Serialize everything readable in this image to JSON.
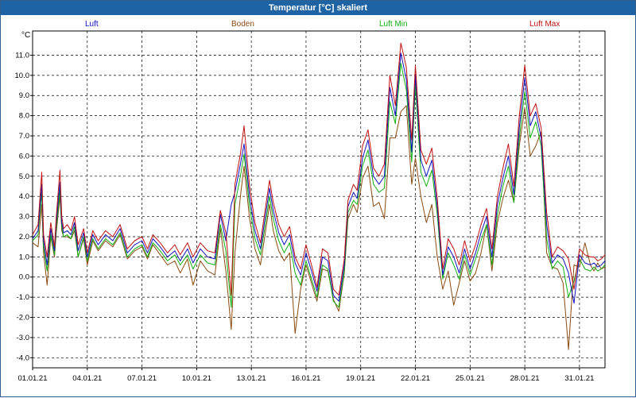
{
  "window": {
    "title": "Temperatur [°C] skaliert"
  },
  "legend": [
    {
      "label": "Luft",
      "color": "#1010c0"
    },
    {
      "label": "Boden",
      "color": "#8b4a10"
    },
    {
      "label": "Luft Min",
      "color": "#10b010"
    },
    {
      "label": "Luft Max",
      "color": "#c01010"
    }
  ],
  "chart_data": {
    "type": "line",
    "title": "Temperatur [°C] skaliert",
    "ylabel": "°C",
    "xlabel": "",
    "ylim": [
      -4.5,
      12.2
    ],
    "xlim": [
      0,
      31.4
    ],
    "grid": true,
    "x_ticks": [
      "01.01.21",
      "04.01.21",
      "07.01.21",
      "10.01.21",
      "13.01.21",
      "16.01.21",
      "19.01.21",
      "22.01.21",
      "25.01.21",
      "28.01.21",
      "31.01.21"
    ],
    "y_ticks": [
      -4.0,
      -3.0,
      -2.0,
      -1.0,
      0.0,
      1.0,
      2.0,
      3.0,
      4.0,
      5.0,
      6.0,
      7.0,
      8.0,
      9.0,
      10.0,
      11.0
    ],
    "x_unit": "days since 01.01.21",
    "series": [
      {
        "name": "Luft",
        "color": "#1010c0",
        "x": [
          0,
          0.3,
          0.5,
          0.6,
          0.8,
          1.0,
          1.2,
          1.3,
          1.5,
          1.6,
          1.7,
          1.9,
          2.1,
          2.3,
          2.5,
          2.8,
          3.0,
          3.3,
          3.6,
          4.0,
          4.4,
          4.8,
          5.2,
          5.6,
          6.0,
          6.3,
          6.6,
          7.0,
          7.4,
          7.8,
          8.1,
          8.5,
          8.8,
          9.2,
          9.6,
          10.0,
          10.3,
          10.6,
          10.9,
          11.1,
          11.4,
          11.6,
          11.9,
          12.2,
          12.5,
          12.8,
          13.0,
          13.2,
          13.5,
          13.8,
          14.1,
          14.4,
          14.7,
          15.0,
          15.3,
          15.6,
          15.9,
          16.2,
          16.5,
          16.8,
          17.1,
          17.3,
          17.6,
          17.8,
          18.1,
          18.4,
          18.7,
          19.0,
          19.3,
          19.6,
          19.9,
          20.2,
          20.5,
          20.8,
          21.0,
          21.3,
          21.6,
          21.9,
          22.2,
          22.5,
          22.8,
          23.1,
          23.4,
          23.7,
          24.0,
          24.3,
          24.6,
          24.9,
          25.2,
          25.5,
          25.8,
          26.1,
          26.4,
          26.7,
          27.0,
          27.3,
          27.6,
          27.9,
          28.2,
          28.5,
          28.8,
          29.1,
          29.4,
          29.7,
          30.0,
          30.3,
          30.6,
          30.8,
          31.0,
          31.2,
          31.4
        ],
        "y": [
          1.9,
          2.3,
          4.6,
          1.8,
          0.6,
          2.4,
          1.3,
          2.7,
          4.7,
          2.7,
          2.2,
          2.3,
          2.1,
          2.7,
          1.3,
          2.2,
          1.0,
          2.1,
          1.6,
          2.1,
          1.8,
          2.4,
          1.2,
          1.6,
          1.8,
          1.2,
          1.9,
          1.5,
          1.0,
          1.3,
          0.8,
          1.4,
          0.7,
          1.4,
          1.0,
          0.9,
          3.1,
          1.8,
          3.6,
          4.2,
          5.6,
          6.6,
          4.0,
          2.3,
          1.4,
          3.2,
          4.4,
          3.3,
          2.2,
          1.6,
          2.1,
          0.7,
          0.1,
          1.2,
          0.3,
          -0.7,
          1.0,
          0.8,
          -0.9,
          -1.2,
          0.6,
          3.5,
          4.2,
          3.9,
          5.9,
          6.8,
          5.0,
          4.6,
          5.0,
          9.4,
          8.0,
          11.1,
          9.8,
          6.2,
          10.0,
          5.8,
          5.0,
          5.8,
          3.5,
          0.1,
          1.5,
          1.0,
          0.2,
          1.4,
          0.4,
          1.2,
          2.2,
          3.0,
          1.0,
          3.6,
          4.9,
          6.0,
          4.1,
          7.4,
          9.9,
          7.5,
          8.2,
          6.9,
          2.6,
          0.7,
          1.1,
          0.9,
          0.2,
          -1.3,
          1.1,
          0.7,
          0.6,
          0.7,
          0.5,
          0.6,
          0.8
        ]
      },
      {
        "name": "Boden",
        "color": "#8b4a10",
        "x": [
          0,
          0.3,
          0.5,
          0.6,
          0.8,
          1.0,
          1.2,
          1.3,
          1.5,
          1.6,
          1.7,
          1.9,
          2.1,
          2.3,
          2.5,
          2.8,
          3.0,
          3.3,
          3.6,
          4.0,
          4.4,
          4.8,
          5.2,
          5.6,
          6.0,
          6.3,
          6.6,
          7.0,
          7.4,
          7.8,
          8.1,
          8.5,
          8.8,
          9.2,
          9.6,
          10.0,
          10.3,
          10.6,
          10.9,
          11.1,
          11.4,
          11.6,
          11.9,
          12.2,
          12.5,
          12.8,
          13.0,
          13.2,
          13.5,
          13.8,
          14.1,
          14.4,
          14.7,
          15.0,
          15.3,
          15.6,
          15.9,
          16.2,
          16.5,
          16.8,
          17.1,
          17.3,
          17.6,
          17.8,
          18.1,
          18.4,
          18.7,
          19.0,
          19.3,
          19.6,
          19.9,
          20.2,
          20.5,
          20.8,
          21.0,
          21.3,
          21.6,
          21.9,
          22.2,
          22.5,
          22.8,
          23.1,
          23.4,
          23.7,
          24.0,
          24.3,
          24.6,
          24.9,
          25.2,
          25.5,
          25.8,
          26.1,
          26.4,
          26.7,
          27.0,
          27.3,
          27.6,
          27.9,
          28.2,
          28.5,
          28.8,
          29.1,
          29.4,
          29.7,
          30.0,
          30.3,
          30.6,
          30.8,
          31.0,
          31.2,
          31.4
        ],
        "y": [
          1.7,
          1.5,
          3.6,
          1.2,
          -0.4,
          2.0,
          1.0,
          2.2,
          4.0,
          2.3,
          2.0,
          2.0,
          1.9,
          2.3,
          1.0,
          1.9,
          0.6,
          1.8,
          1.3,
          1.8,
          1.5,
          2.1,
          0.9,
          1.3,
          1.5,
          0.9,
          1.6,
          1.1,
          0.6,
          0.8,
          0.2,
          0.9,
          -0.4,
          0.8,
          0.3,
          0.1,
          2.4,
          0.3,
          -2.6,
          1.2,
          4.0,
          5.5,
          2.9,
          1.4,
          0.6,
          2.4,
          3.6,
          2.3,
          1.3,
          0.8,
          1.2,
          -2.8,
          -0.6,
          0.6,
          -0.3,
          -1.2,
          0.4,
          0.3,
          -1.1,
          -1.7,
          0.2,
          2.9,
          3.6,
          3.2,
          4.9,
          5.5,
          3.5,
          3.7,
          2.9,
          6.9,
          6.9,
          8.2,
          8.5,
          4.6,
          5.9,
          4.0,
          2.7,
          3.6,
          1.0,
          -0.6,
          0.3,
          -1.4,
          -0.3,
          0.8,
          -0.2,
          0.2,
          1.2,
          2.6,
          0.3,
          2.7,
          3.9,
          4.8,
          3.7,
          6.5,
          8.4,
          6.0,
          6.5,
          7.2,
          1.2,
          0.5,
          0.4,
          -0.3,
          -3.6,
          0.6,
          0.5,
          1.7,
          0.6,
          0.3,
          0.7,
          0.4,
          0.5
        ]
      },
      {
        "name": "Luft Min",
        "color": "#10b010",
        "x": [
          0,
          0.3,
          0.5,
          0.6,
          0.8,
          1.0,
          1.2,
          1.3,
          1.5,
          1.6,
          1.7,
          1.9,
          2.1,
          2.3,
          2.5,
          2.8,
          3.0,
          3.3,
          3.6,
          4.0,
          4.4,
          4.8,
          5.2,
          5.6,
          6.0,
          6.3,
          6.6,
          7.0,
          7.4,
          7.8,
          8.1,
          8.5,
          8.8,
          9.2,
          9.6,
          10.0,
          10.3,
          10.6,
          10.9,
          11.1,
          11.4,
          11.6,
          11.9,
          12.2,
          12.5,
          12.8,
          13.0,
          13.2,
          13.5,
          13.8,
          14.1,
          14.4,
          14.7,
          15.0,
          15.3,
          15.6,
          15.9,
          16.2,
          16.5,
          16.8,
          17.1,
          17.3,
          17.6,
          17.8,
          18.1,
          18.4,
          18.7,
          19.0,
          19.3,
          19.6,
          19.9,
          20.2,
          20.5,
          20.8,
          21.0,
          21.3,
          21.6,
          21.9,
          22.2,
          22.5,
          22.8,
          23.1,
          23.4,
          23.7,
          24.0,
          24.3,
          24.6,
          24.9,
          25.2,
          25.5,
          25.8,
          26.1,
          26.4,
          26.7,
          27.0,
          27.3,
          27.6,
          27.9,
          28.2,
          28.5,
          28.8,
          29.1,
          29.4,
          29.7,
          30.0,
          30.3,
          30.6,
          30.8,
          31.0,
          31.2,
          31.4
        ],
        "y": [
          1.8,
          2.1,
          4.2,
          1.5,
          0.3,
          2.1,
          1.1,
          2.4,
          4.3,
          2.5,
          2.0,
          2.1,
          1.9,
          2.5,
          1.0,
          2.0,
          0.8,
          1.9,
          1.4,
          1.9,
          1.6,
          2.2,
          1.0,
          1.4,
          1.6,
          1.0,
          1.7,
          1.3,
          0.8,
          1.1,
          0.6,
          1.1,
          0.4,
          1.1,
          0.7,
          0.6,
          2.6,
          1.3,
          -1.5,
          3.6,
          5.0,
          6.1,
          3.5,
          1.9,
          1.1,
          2.8,
          4.0,
          2.9,
          1.8,
          1.2,
          1.7,
          0.2,
          -0.4,
          0.8,
          -0.1,
          -1.0,
          0.6,
          0.4,
          -1.2,
          -1.5,
          0.3,
          3.2,
          3.8,
          3.6,
          5.5,
          6.3,
          4.6,
          4.2,
          4.4,
          8.7,
          7.6,
          10.6,
          9.3,
          5.7,
          9.5,
          5.2,
          4.5,
          5.3,
          3.1,
          -0.1,
          1.2,
          0.6,
          -0.1,
          1.1,
          0.1,
          0.9,
          1.8,
          2.6,
          0.6,
          3.1,
          4.5,
          5.5,
          3.7,
          6.9,
          9.2,
          6.9,
          7.7,
          6.5,
          1.9,
          0.4,
          0.8,
          0.5,
          -1.0,
          -0.2,
          0.9,
          0.4,
          0.3,
          0.5,
          0.3,
          0.4,
          0.6
        ]
      },
      {
        "name": "Luft Max",
        "color": "#c01010",
        "x": [
          0,
          0.3,
          0.5,
          0.6,
          0.8,
          1.0,
          1.2,
          1.3,
          1.5,
          1.6,
          1.7,
          1.9,
          2.1,
          2.3,
          2.5,
          2.8,
          3.0,
          3.3,
          3.6,
          4.0,
          4.4,
          4.8,
          5.2,
          5.6,
          6.0,
          6.3,
          6.6,
          7.0,
          7.4,
          7.8,
          8.1,
          8.5,
          8.8,
          9.2,
          9.6,
          10.0,
          10.3,
          10.6,
          10.9,
          11.1,
          11.4,
          11.6,
          11.9,
          12.2,
          12.5,
          12.8,
          13.0,
          13.2,
          13.5,
          13.8,
          14.1,
          14.4,
          14.7,
          15.0,
          15.3,
          15.6,
          15.9,
          16.2,
          16.5,
          16.8,
          17.1,
          17.3,
          17.6,
          17.8,
          18.1,
          18.4,
          18.7,
          19.0,
          19.3,
          19.6,
          19.9,
          20.2,
          20.5,
          20.8,
          21.0,
          21.3,
          21.6,
          21.9,
          22.2,
          22.5,
          22.8,
          23.1,
          23.4,
          23.7,
          24.0,
          24.3,
          24.6,
          24.9,
          25.2,
          25.5,
          25.8,
          26.1,
          26.4,
          26.7,
          27.0,
          27.3,
          27.6,
          27.9,
          28.2,
          28.5,
          28.8,
          29.1,
          29.4,
          29.7,
          30.0,
          30.3,
          30.6,
          30.8,
          31.0,
          31.2,
          31.4
        ],
        "y": [
          2.1,
          2.6,
          5.2,
          2.1,
          1.0,
          2.7,
          1.5,
          3.0,
          5.3,
          3.0,
          2.4,
          2.6,
          2.3,
          3.0,
          1.6,
          2.4,
          1.2,
          2.3,
          1.8,
          2.3,
          2.0,
          2.6,
          1.4,
          1.8,
          2.0,
          1.4,
          2.1,
          1.7,
          1.2,
          1.6,
          1.1,
          1.7,
          1.0,
          1.7,
          1.3,
          1.2,
          3.3,
          2.2,
          -0.9,
          4.6,
          6.1,
          7.5,
          4.5,
          2.7,
          1.7,
          3.6,
          4.8,
          3.7,
          2.6,
          2.0,
          2.5,
          1.0,
          0.4,
          1.6,
          0.6,
          -0.5,
          1.4,
          1.2,
          -0.6,
          -0.9,
          0.9,
          3.8,
          4.6,
          4.3,
          6.5,
          7.3,
          5.4,
          5.0,
          5.6,
          10.0,
          8.5,
          11.6,
          10.4,
          6.8,
          10.5,
          6.3,
          5.6,
          6.4,
          3.9,
          0.4,
          1.9,
          1.4,
          0.6,
          1.8,
          0.8,
          1.6,
          2.6,
          3.4,
          1.4,
          4.0,
          5.4,
          6.6,
          4.5,
          8.0,
          10.5,
          8.0,
          8.6,
          7.4,
          3.2,
          1.0,
          1.5,
          1.3,
          0.9,
          -0.6,
          1.4,
          1.1,
          1.0,
          1.0,
          0.8,
          0.9,
          1.1
        ]
      }
    ]
  }
}
